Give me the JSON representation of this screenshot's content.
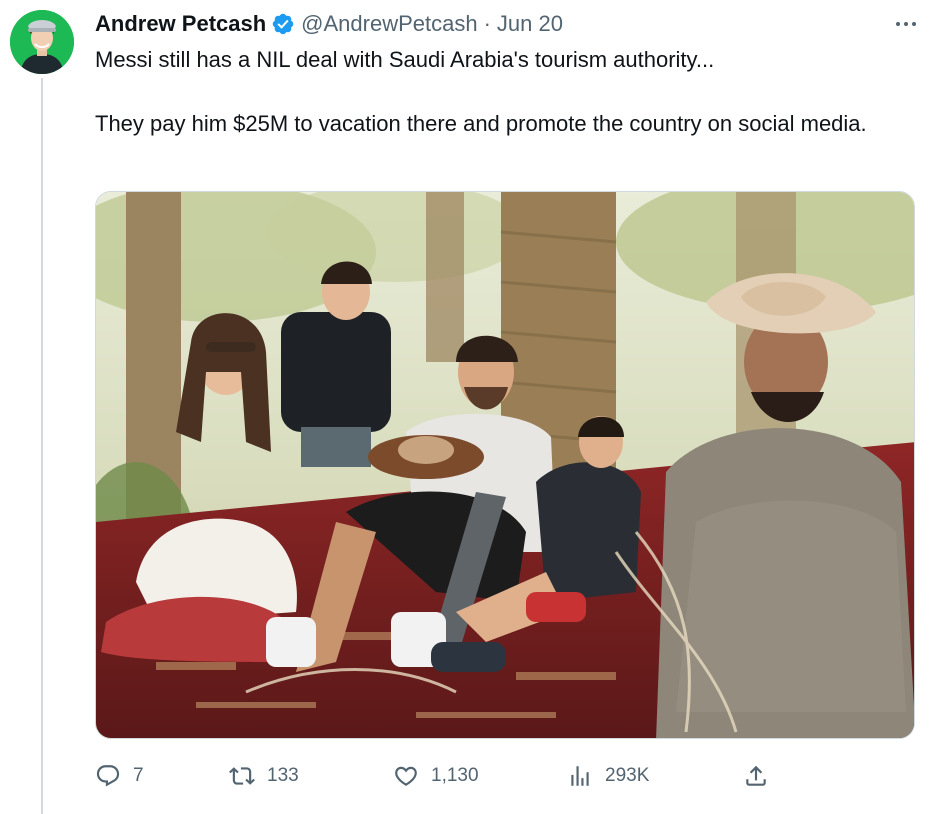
{
  "tweet": {
    "display_name": "Andrew Petcash",
    "handle": "@AndrewPetcash",
    "separator": "·",
    "date": "Jun 20",
    "text_line1": "Messi still has a NIL deal with Saudi Arabia's tourism authority...",
    "text_line2": "They pay him $25M to vacation there and promote the country on social media."
  },
  "actions": {
    "replies": "7",
    "retweets": "133",
    "likes": "1,130",
    "views": "293K"
  },
  "colors": {
    "verified": "#1d9bf0",
    "avatar_bg": "#1db954",
    "muted": "#536471",
    "thread_line": "#cfd9de"
  },
  "icons": {
    "verified": "verified-badge-icon",
    "more": "more-horizontal-icon",
    "reply": "reply-icon",
    "retweet": "retweet-icon",
    "like": "heart-icon",
    "views": "views-chart-icon",
    "share": "share-icon"
  }
}
